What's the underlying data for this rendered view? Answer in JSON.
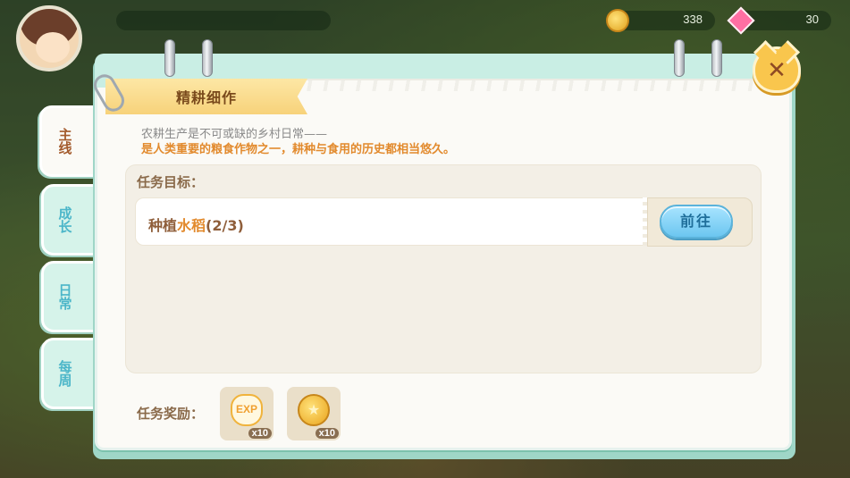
{
  "hud": {
    "coins": "338",
    "gems": "30"
  },
  "panel": {
    "title": "精耕细作",
    "close_icon": "close-icon"
  },
  "tabs": [
    {
      "label": "主线",
      "active": true
    },
    {
      "label": "成长",
      "active": false
    },
    {
      "label": "日常",
      "active": false
    },
    {
      "label": "每周",
      "active": false
    }
  ],
  "description": {
    "line1": "农耕生产是不可或缺的乡村日常——",
    "line2": "是人类重要的粮食作物之一，耕种与食用的历史都相当悠久。"
  },
  "task": {
    "section_title": "任务目标：",
    "name_prefix": "种植",
    "name_highlight": "水稻",
    "progress": "(2/3)",
    "go_button": "前往"
  },
  "rewards": {
    "label": "任务奖励：",
    "items": [
      {
        "icon": "exp-icon",
        "text": "EXP",
        "qty": "x10"
      },
      {
        "icon": "coin-icon",
        "text": "★",
        "qty": "x10"
      }
    ]
  },
  "colors": {
    "accent_orange": "#e28a2d",
    "tab_teal": "#4cb6c9",
    "button_blue": "#6cc6f0"
  }
}
